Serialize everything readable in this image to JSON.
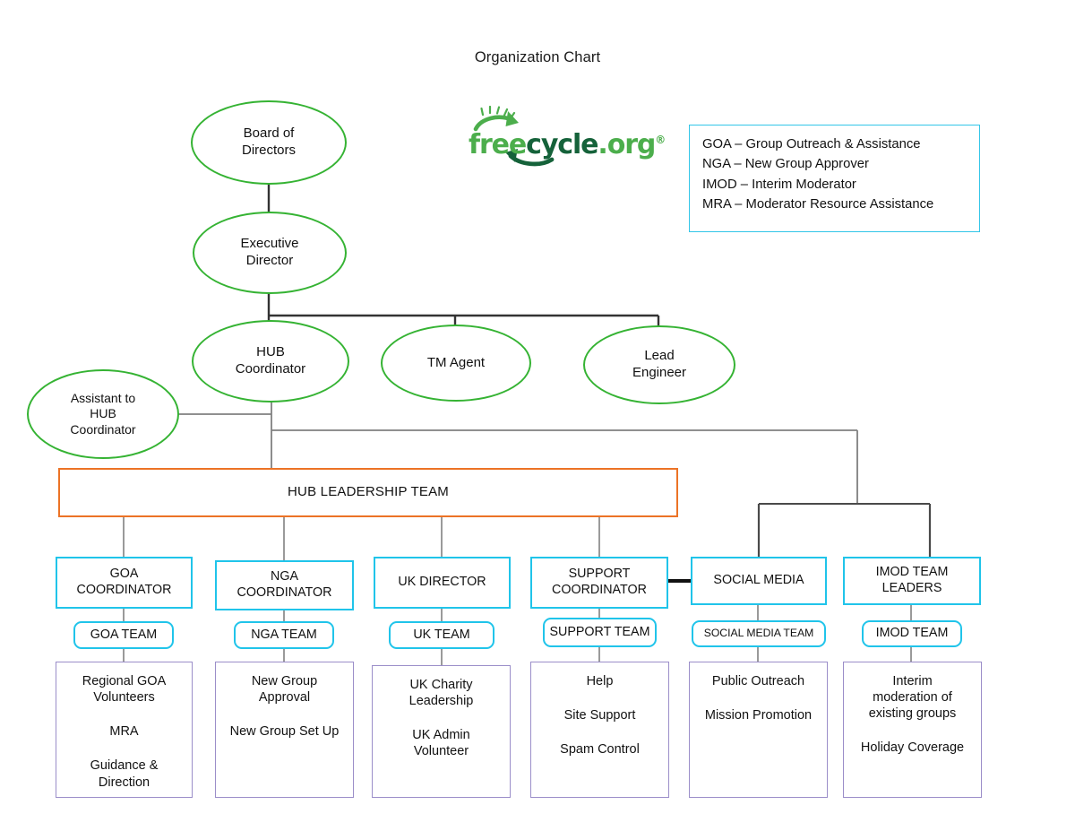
{
  "title": "Organization Chart",
  "logo": {
    "name": "freecycle-org-logo",
    "part_free": "free",
    "part_cycle": "cycle",
    "part_org": ".org",
    "registered_mark": "®",
    "color_light_green": "#4cae4c",
    "color_dark_green": "#15623a"
  },
  "legend": {
    "lines": [
      "GOA – Group Outreach & Assistance",
      "NGA – New Group Approver",
      "IMOD – Interim Moderator",
      "MRA – Moderator Resource Assistance"
    ],
    "border_color": "#33c6e8"
  },
  "ellipses": {
    "board": "Board of\nDirectors",
    "board_l1": "Board of",
    "board_l2": "Directors",
    "exec_l1": "Executive",
    "exec_l2": "Director",
    "hub_l1": "HUB",
    "hub_l2": "Coordinator",
    "tm_agent": "TM Agent",
    "lead_l1": "Lead",
    "lead_l2": "Engineer",
    "assistant_l1": "Assistant to",
    "assistant_l2": "HUB",
    "assistant_l3": "Coordinator",
    "border_color": "#35b333"
  },
  "leadership_bar": {
    "label": "HUB LEADERSHIP TEAM",
    "border_color": "#ec7326"
  },
  "columns": [
    {
      "coordinator_l1": "GOA",
      "coordinator_l2": "COORDINATOR",
      "team": "GOA TEAM",
      "details": [
        "Regional GOA",
        "Volunteers",
        "MRA",
        "Guidance &",
        "Direction"
      ]
    },
    {
      "coordinator_l1": "NGA",
      "coordinator_l2": "COORDINATOR",
      "team": "NGA TEAM",
      "details": [
        "New Group",
        "Approval",
        "New Group Set Up"
      ]
    },
    {
      "coordinator_l1": "UK DIRECTOR",
      "coordinator_l2": "",
      "team": "UK TEAM",
      "details": [
        "UK Charity",
        "Leadership",
        "UK Admin",
        "Volunteer"
      ]
    },
    {
      "coordinator_l1": "SUPPORT",
      "coordinator_l2": "COORDINATOR",
      "team": "SUPPORT TEAM",
      "details": [
        "Help",
        "Site Support",
        "Spam Control"
      ]
    },
    {
      "coordinator_l1": "SOCIAL MEDIA",
      "coordinator_l2": "",
      "team": "SOCIAL MEDIA TEAM",
      "details": [
        "Public Outreach",
        "Mission Promotion"
      ]
    },
    {
      "coordinator_l1": "IMOD TEAM",
      "coordinator_l2": "LEADERS",
      "team": "IMOD TEAM",
      "details": [
        "Interim",
        "moderation of",
        "existing groups",
        "Holiday Coverage"
      ]
    }
  ],
  "colors": {
    "cyan": "#20c4ea",
    "orange": "#ec7326",
    "purple": "#9b8ec9",
    "green": "#35b333",
    "wire": "#808080",
    "wire_dark": "#333333"
  }
}
